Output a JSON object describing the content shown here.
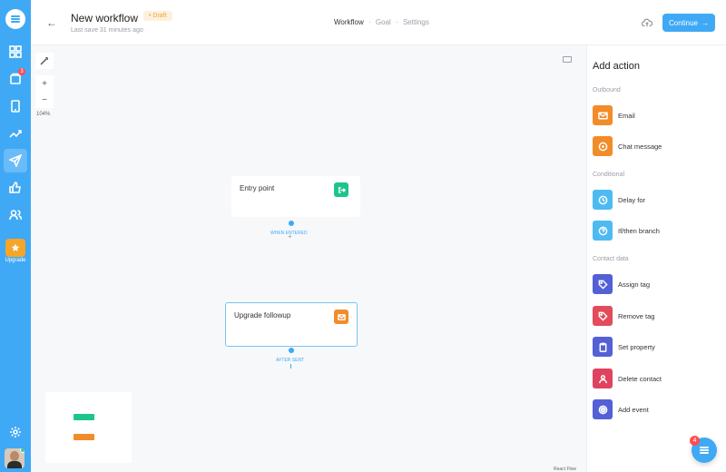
{
  "colors": {
    "brand": "#3fa9f5",
    "orange": "#f28c28",
    "green": "#1dc48b",
    "cyan": "#4dbbf1",
    "indigo": "#5360d6",
    "red": "#e24c5b",
    "pink": "#e0435f",
    "badge": "#ff4d4f"
  },
  "nav": {
    "logo_icon": "menu-lines-icon",
    "items": [
      {
        "icon": "grid-icon"
      },
      {
        "icon": "inbox-icon",
        "badge": "3"
      },
      {
        "icon": "tablet-icon"
      },
      {
        "icon": "trend-up-icon"
      },
      {
        "icon": "send-icon"
      },
      {
        "icon": "thumbs-up-icon"
      },
      {
        "icon": "users-icon"
      }
    ],
    "upgrade_label": "Upgrade",
    "settings_icon": "gear-icon"
  },
  "header": {
    "title": "New workflow",
    "status": "• Draft",
    "last_save": "Last save 31 minutes ago",
    "steps": [
      "Workflow",
      "Goal",
      "Settings"
    ],
    "active_step": "Workflow",
    "step_separator": "·",
    "continue_label": "Continue",
    "continue_arrow": "→",
    "back_arrow": "←"
  },
  "canvas": {
    "zoom_level": "104%",
    "zoom_in": "+",
    "zoom_out": "−",
    "nodes": [
      {
        "title": "Entry point",
        "icon": "entry-icon",
        "edge_label": "WHEN ENTERED"
      },
      {
        "title": "Upgrade followup",
        "icon": "email-icon",
        "edge_label": "AFTER SENT"
      }
    ],
    "plus": "+",
    "attribution": "React Flow"
  },
  "panel": {
    "title": "Add action",
    "sections": [
      {
        "label": "Outbound",
        "items": [
          {
            "label": "Email",
            "icon": "email-icon",
            "color": "#f28c28"
          },
          {
            "label": "Chat message",
            "icon": "chat-icon",
            "color": "#f28c28"
          }
        ]
      },
      {
        "label": "Conditional",
        "items": [
          {
            "label": "Delay for",
            "icon": "clock-icon",
            "color": "#4dbbf1"
          },
          {
            "label": "If/then branch",
            "icon": "question-icon",
            "color": "#4dbbf1"
          }
        ]
      },
      {
        "label": "Contact data",
        "items": [
          {
            "label": "Assign tag",
            "icon": "tag-icon",
            "color": "#5360d6"
          },
          {
            "label": "Remove tag",
            "icon": "tag-icon",
            "color": "#e24c5b"
          },
          {
            "label": "Set property",
            "icon": "clipboard-icon",
            "color": "#5360d6"
          },
          {
            "label": "Delete contact",
            "icon": "user-icon",
            "color": "#e0435f"
          },
          {
            "label": "Add event",
            "icon": "target-icon",
            "color": "#5360d6"
          }
        ]
      }
    ]
  },
  "chat_widget": {
    "badge": "4"
  }
}
